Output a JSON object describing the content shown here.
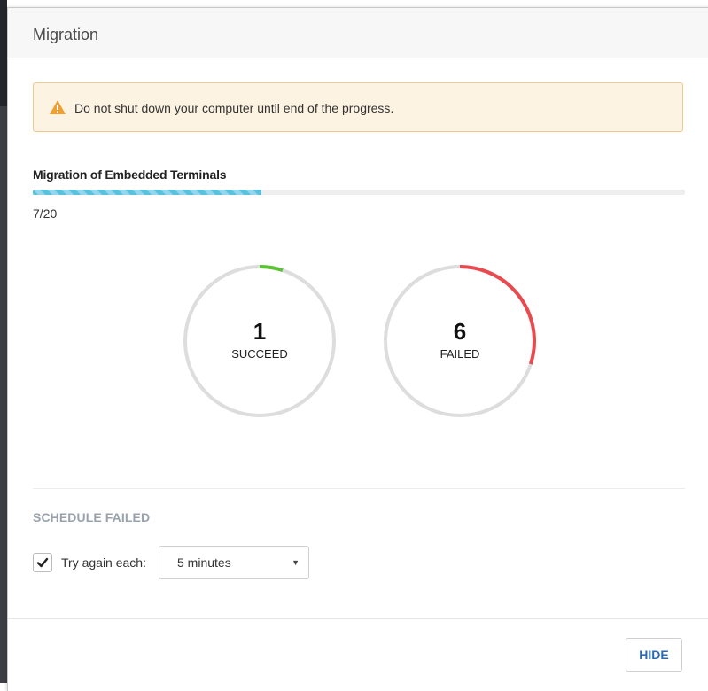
{
  "modal": {
    "title": "Migration"
  },
  "warning": {
    "icon": "warning-triangle-icon",
    "color": "#f0a030",
    "text": "Do not shut down your computer until end of the progress."
  },
  "progress": {
    "title": "Migration of Embedded Terminals",
    "count_text": "7/20",
    "completed": 7,
    "total": 20,
    "bar_color": "#5bc0de"
  },
  "results": {
    "succeed": {
      "value": "1",
      "label": "SUCCEED",
      "fraction": 0.05,
      "color": "#5bc236"
    },
    "failed": {
      "value": "6",
      "label": "FAILED",
      "fraction": 0.3,
      "color": "#e84a4f"
    },
    "track_color": "#dddddd"
  },
  "schedule": {
    "title": "SCHEDULE FAILED",
    "try_again_label": "Try again each:",
    "try_again_checked": true,
    "interval_selected": "5 minutes"
  },
  "footer": {
    "hide_label": "HIDE"
  }
}
